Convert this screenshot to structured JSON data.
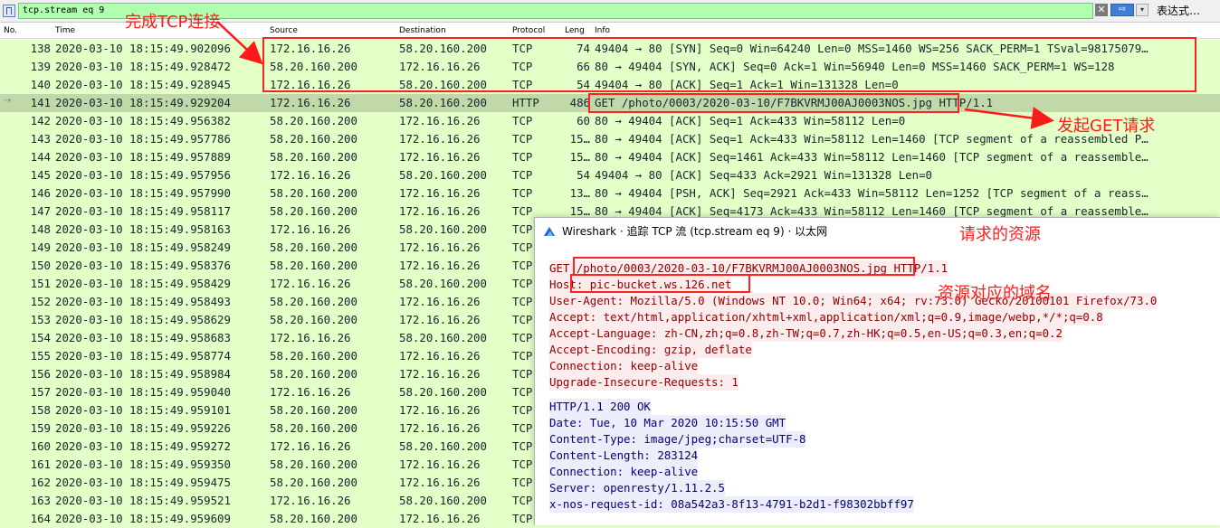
{
  "filter": {
    "value": "tcp.stream eq 9",
    "clear_label": "✕",
    "apply_label": "⇨",
    "dropdown_label": "▾",
    "expression_label": "表达式…"
  },
  "columns": [
    "No.",
    "Time",
    "Source",
    "Destination",
    "Protocol",
    "Leng",
    "Info"
  ],
  "packets": [
    {
      "no": "138",
      "time": "2020-03-10 18:15:49.902096",
      "src": "172.16.16.26",
      "dst": "58.20.160.200",
      "proto": "TCP",
      "len": "74",
      "info": "49404 → 80 [SYN] Seq=0 Win=64240 Len=0 MSS=1460 WS=256 SACK_PERM=1 TSval=98175079…"
    },
    {
      "no": "139",
      "time": "2020-03-10 18:15:49.928472",
      "src": "58.20.160.200",
      "dst": "172.16.16.26",
      "proto": "TCP",
      "len": "66",
      "info": "80 → 49404 [SYN, ACK] Seq=0 Ack=1 Win=56940 Len=0 MSS=1460 SACK_PERM=1 WS=128"
    },
    {
      "no": "140",
      "time": "2020-03-10 18:15:49.928945",
      "src": "172.16.16.26",
      "dst": "58.20.160.200",
      "proto": "TCP",
      "len": "54",
      "info": "49404 → 80 [ACK] Seq=1 Ack=1 Win=131328 Len=0"
    },
    {
      "no": "141",
      "time": "2020-03-10 18:15:49.929204",
      "src": "172.16.16.26",
      "dst": "58.20.160.200",
      "proto": "HTTP",
      "len": "486",
      "info": "GET /photo/0003/2020-03-10/F7BKVRMJ00AJ0003NOS.jpg HTTP/1.1"
    },
    {
      "no": "142",
      "time": "2020-03-10 18:15:49.956382",
      "src": "58.20.160.200",
      "dst": "172.16.16.26",
      "proto": "TCP",
      "len": "60",
      "info": "80 → 49404 [ACK] Seq=1 Ack=433 Win=58112 Len=0"
    },
    {
      "no": "143",
      "time": "2020-03-10 18:15:49.957786",
      "src": "58.20.160.200",
      "dst": "172.16.16.26",
      "proto": "TCP",
      "len": "15…",
      "info": "80 → 49404 [ACK] Seq=1 Ack=433 Win=58112 Len=1460 [TCP segment of a reassembled P…"
    },
    {
      "no": "144",
      "time": "2020-03-10 18:15:49.957889",
      "src": "58.20.160.200",
      "dst": "172.16.16.26",
      "proto": "TCP",
      "len": "15…",
      "info": "80 → 49404 [ACK] Seq=1461 Ack=433 Win=58112 Len=1460 [TCP segment of a reassemble…"
    },
    {
      "no": "145",
      "time": "2020-03-10 18:15:49.957956",
      "src": "172.16.16.26",
      "dst": "58.20.160.200",
      "proto": "TCP",
      "len": "54",
      "info": "49404 → 80 [ACK] Seq=433 Ack=2921 Win=131328 Len=0"
    },
    {
      "no": "146",
      "time": "2020-03-10 18:15:49.957990",
      "src": "58.20.160.200",
      "dst": "172.16.16.26",
      "proto": "TCP",
      "len": "13…",
      "info": "80 → 49404 [PSH, ACK] Seq=2921 Ack=433 Win=58112 Len=1252 [TCP segment of a reass…"
    },
    {
      "no": "147",
      "time": "2020-03-10 18:15:49.958117",
      "src": "58.20.160.200",
      "dst": "172.16.16.26",
      "proto": "TCP",
      "len": "15…",
      "info": "80 → 49404 [ACK] Seq=4173 Ack=433 Win=58112 Len=1460 [TCP segment of a reassemble…"
    },
    {
      "no": "148",
      "time": "2020-03-10 18:15:49.958163",
      "src": "172.16.16.26",
      "dst": "58.20.160.200",
      "proto": "TCP",
      "len": "",
      "info": ""
    },
    {
      "no": "149",
      "time": "2020-03-10 18:15:49.958249",
      "src": "58.20.160.200",
      "dst": "172.16.16.26",
      "proto": "TCP",
      "len": "",
      "info": ""
    },
    {
      "no": "150",
      "time": "2020-03-10 18:15:49.958376",
      "src": "58.20.160.200",
      "dst": "172.16.16.26",
      "proto": "TCP",
      "len": "",
      "info": ""
    },
    {
      "no": "151",
      "time": "2020-03-10 18:15:49.958429",
      "src": "172.16.16.26",
      "dst": "58.20.160.200",
      "proto": "TCP",
      "len": "",
      "info": ""
    },
    {
      "no": "152",
      "time": "2020-03-10 18:15:49.958493",
      "src": "58.20.160.200",
      "dst": "172.16.16.26",
      "proto": "TCP",
      "len": "",
      "info": ""
    },
    {
      "no": "153",
      "time": "2020-03-10 18:15:49.958629",
      "src": "58.20.160.200",
      "dst": "172.16.16.26",
      "proto": "TCP",
      "len": "",
      "info": ""
    },
    {
      "no": "154",
      "time": "2020-03-10 18:15:49.958683",
      "src": "172.16.16.26",
      "dst": "58.20.160.200",
      "proto": "TCP",
      "len": "",
      "info": ""
    },
    {
      "no": "155",
      "time": "2020-03-10 18:15:49.958774",
      "src": "58.20.160.200",
      "dst": "172.16.16.26",
      "proto": "TCP",
      "len": "",
      "info": ""
    },
    {
      "no": "156",
      "time": "2020-03-10 18:15:49.958984",
      "src": "58.20.160.200",
      "dst": "172.16.16.26",
      "proto": "TCP",
      "len": "",
      "info": ""
    },
    {
      "no": "157",
      "time": "2020-03-10 18:15:49.959040",
      "src": "172.16.16.26",
      "dst": "58.20.160.200",
      "proto": "TCP",
      "len": "",
      "info": ""
    },
    {
      "no": "158",
      "time": "2020-03-10 18:15:49.959101",
      "src": "58.20.160.200",
      "dst": "172.16.16.26",
      "proto": "TCP",
      "len": "",
      "info": ""
    },
    {
      "no": "159",
      "time": "2020-03-10 18:15:49.959226",
      "src": "58.20.160.200",
      "dst": "172.16.16.26",
      "proto": "TCP",
      "len": "",
      "info": ""
    },
    {
      "no": "160",
      "time": "2020-03-10 18:15:49.959272",
      "src": "172.16.16.26",
      "dst": "58.20.160.200",
      "proto": "TCP",
      "len": "",
      "info": ""
    },
    {
      "no": "161",
      "time": "2020-03-10 18:15:49.959350",
      "src": "58.20.160.200",
      "dst": "172.16.16.26",
      "proto": "TCP",
      "len": "",
      "info": ""
    },
    {
      "no": "162",
      "time": "2020-03-10 18:15:49.959475",
      "src": "58.20.160.200",
      "dst": "172.16.16.26",
      "proto": "TCP",
      "len": "",
      "info": ""
    },
    {
      "no": "163",
      "time": "2020-03-10 18:15:49.959521",
      "src": "172.16.16.26",
      "dst": "58.20.160.200",
      "proto": "TCP",
      "len": "",
      "info": ""
    },
    {
      "no": "164",
      "time": "2020-03-10 18:15:49.959609",
      "src": "58.20.160.200",
      "dst": "172.16.16.26",
      "proto": "TCP",
      "len": "",
      "info": ""
    }
  ],
  "selected_packet": "141",
  "follow_window": {
    "title": "Wireshark · 追踪 TCP 流 (tcp.stream eq 9) · 以太网",
    "request_lines": [
      "GET /photo/0003/2020-03-10/F7BKVRMJ00AJ0003NOS.jpg HTTP/1.1",
      "Host: pic-bucket.ws.126.net",
      "User-Agent: Mozilla/5.0 (Windows NT 10.0; Win64; x64; rv:73.0) Gecko/20100101 Firefox/73.0",
      "Accept: text/html,application/xhtml+xml,application/xml;q=0.9,image/webp,*/*;q=0.8",
      "Accept-Language: zh-CN,zh;q=0.8,zh-TW;q=0.7,zh-HK;q=0.5,en-US;q=0.3,en;q=0.2",
      "Accept-Encoding: gzip, deflate",
      "Connection: keep-alive",
      "Upgrade-Insecure-Requests: 1"
    ],
    "response_lines": [
      "HTTP/1.1 200 OK",
      "Date: Tue, 10 Mar 2020 10:15:50 GMT",
      "Content-Type: image/jpeg;charset=UTF-8",
      "Content-Length: 283124",
      "Connection: keep-alive",
      "Server: openresty/1.11.2.5",
      "x-nos-request-id: 08a542a3-8f13-4791-b2d1-f98302bbff97"
    ]
  },
  "annotations": {
    "tcp_handshake": "完成TCP连接",
    "get_request": "发起GET请求",
    "requested_resource": "请求的资源",
    "resource_domain": "资源对应的域名"
  },
  "colors": {
    "tcp_row": "#e4ffc7",
    "selected_row": "#c1d8a9",
    "annotation_red": "#ff1a1a",
    "request_text": "#8b0000",
    "response_text": "#00007f",
    "filter_bg": "#afffaf"
  }
}
